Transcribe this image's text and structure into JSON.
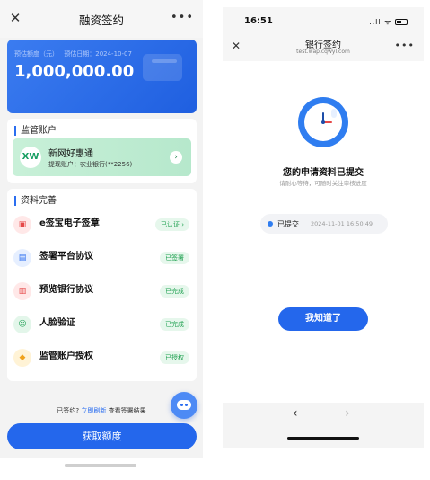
{
  "left": {
    "header": {
      "close_icon": "close-icon",
      "title": "融资签约",
      "more": "•••"
    },
    "quota": {
      "label": "预估额度（元）",
      "date": "预估日期：2024-10-07",
      "amount": "1,000,000.00"
    },
    "supervision": {
      "title": "监管账户",
      "bank_name": "新网好惠通",
      "logo_text": "XW",
      "account": "提现账户：农业银行(**2256)"
    },
    "materials": {
      "title": "资料完善",
      "items": [
        {
          "name": "e签宝电子签章",
          "tag": "已认证 ›",
          "icon": "seal-icon"
        },
        {
          "name": "签署平台协议",
          "tag": "已签署",
          "icon": "document-icon"
        },
        {
          "name": "预览银行协议",
          "tag": "已完成",
          "icon": "bank-doc-icon"
        },
        {
          "name": "人脸验证",
          "tag": "已完成",
          "icon": "face-scan-icon"
        },
        {
          "name": "监管账户授权",
          "tag": "已授权",
          "icon": "shield-icon"
        }
      ]
    },
    "signed_note": {
      "prefix": "已签约?",
      "link": "立即刷新",
      "suffix": "查看签署结果"
    },
    "get_button": "获取额度"
  },
  "right": {
    "status_bar": {
      "time": "16:51",
      "indicators": "..ll ᯤ"
    },
    "nav": {
      "title": "银行签约",
      "url": "test.wap.cqwyl.com",
      "more": "•••"
    },
    "message": "您的申请资料已提交",
    "sub": "请耐心等待，可随时关注审核进度",
    "status": {
      "text": "已提交",
      "time": "2024-11-01 16:50:49"
    },
    "button": "我知道了",
    "back": "‹",
    "forward": "›"
  },
  "colors": {
    "primary": "#2467ec",
    "tag_green": "#1fa050",
    "bank_bg": "#c8f0d8"
  }
}
